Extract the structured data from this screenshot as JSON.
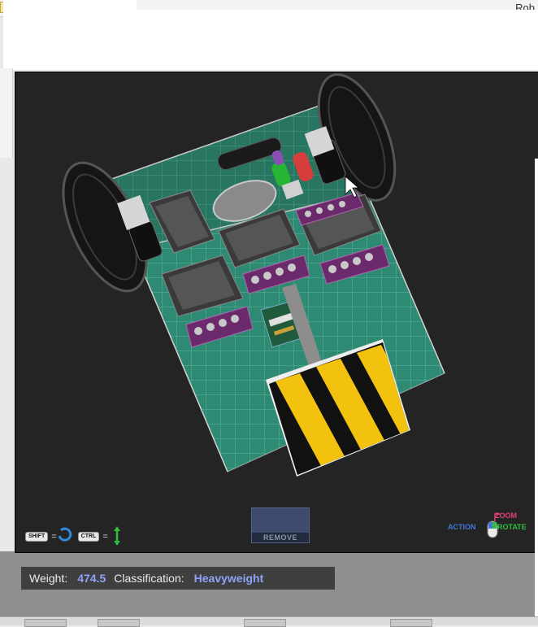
{
  "window": {
    "top_right_text": "Rob"
  },
  "controls": {
    "shift_key": "SHIFT",
    "ctrl_key": "CTRL",
    "equals": "="
  },
  "remove_button": {
    "label": "REMOVE"
  },
  "mouse_legend": {
    "zoom": "ZOOM",
    "action": "ACTION",
    "rotate": "ROTATE"
  },
  "status": {
    "weight_label": "Weight:",
    "weight_value": "474.5",
    "class_label": "Classification:",
    "class_value": "Heavyweight"
  },
  "colors": {
    "viewport_bg": "#242424",
    "floor_green": "#2e8a72",
    "hazard_yellow": "#f3c20e",
    "battery_purple": "#7a2e7a",
    "status_value_blue": "#8fa4ff"
  },
  "icons": [
    "rotate-icon",
    "vertical-move-icon",
    "wrench-icon",
    "arrow-right-icon",
    "mouse-icon"
  ]
}
